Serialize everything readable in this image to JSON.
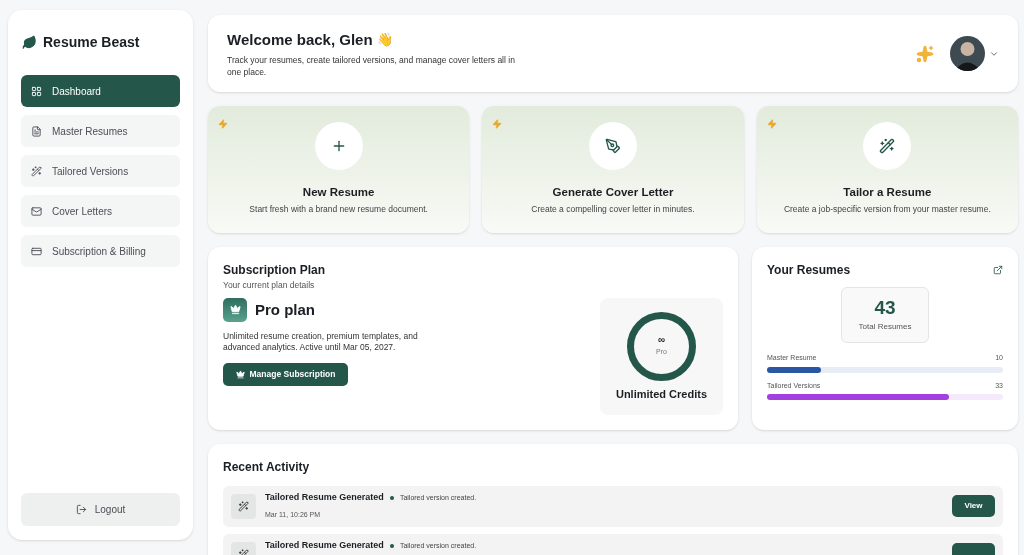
{
  "brand": "Resume Beast",
  "nav": [
    {
      "label": "Dashboard",
      "selected": true
    },
    {
      "label": "Master Resumes",
      "selected": false
    },
    {
      "label": "Tailored Versions",
      "selected": false
    },
    {
      "label": "Cover Letters",
      "selected": false
    },
    {
      "label": "Subscription & Billing",
      "selected": false
    }
  ],
  "logout": "Logout",
  "header": {
    "title": "Welcome back, Glen",
    "emoji": "👋",
    "subtitle": "Track your resumes, create tailored versions, and manage cover letters all in one place."
  },
  "actions": [
    {
      "title": "New Resume",
      "description": "Start fresh with a brand new resume document."
    },
    {
      "title": "Generate Cover Letter",
      "description": "Create a compelling cover letter in minutes."
    },
    {
      "title": "Tailor a Resume",
      "description": "Create a job-specific version from your master resume."
    }
  ],
  "subscription": {
    "title": "Subscription Plan",
    "subtitle": "Your current plan details",
    "plan": "Pro plan",
    "description": "Unlimited resume creation, premium templates, and advanced analytics. Active until Mar 05, 2027.",
    "button": "Manage Subscription",
    "credits_symbol": "∞",
    "credits_tier": "Pro",
    "credits_label": "Unlimited Credits"
  },
  "resumes": {
    "title": "Your Resumes",
    "total": "43",
    "total_label": "Total Resumes",
    "bars": [
      {
        "label": "Master Resume",
        "count": "10",
        "level": 0.23,
        "color": "#2957a4"
      },
      {
        "label": "Tailored Versions",
        "count": "33",
        "level": 0.77,
        "color": "#a43fe0"
      }
    ]
  },
  "activity": {
    "title": "Recent Activity",
    "items": [
      {
        "title": "Tailored Resume Generated",
        "detail": "Tailored version created.",
        "time": "Mar 11, 10:26 PM",
        "button": "View"
      },
      {
        "title": "Tailored Resume Generated",
        "detail": "Tailored version created."
      }
    ]
  }
}
